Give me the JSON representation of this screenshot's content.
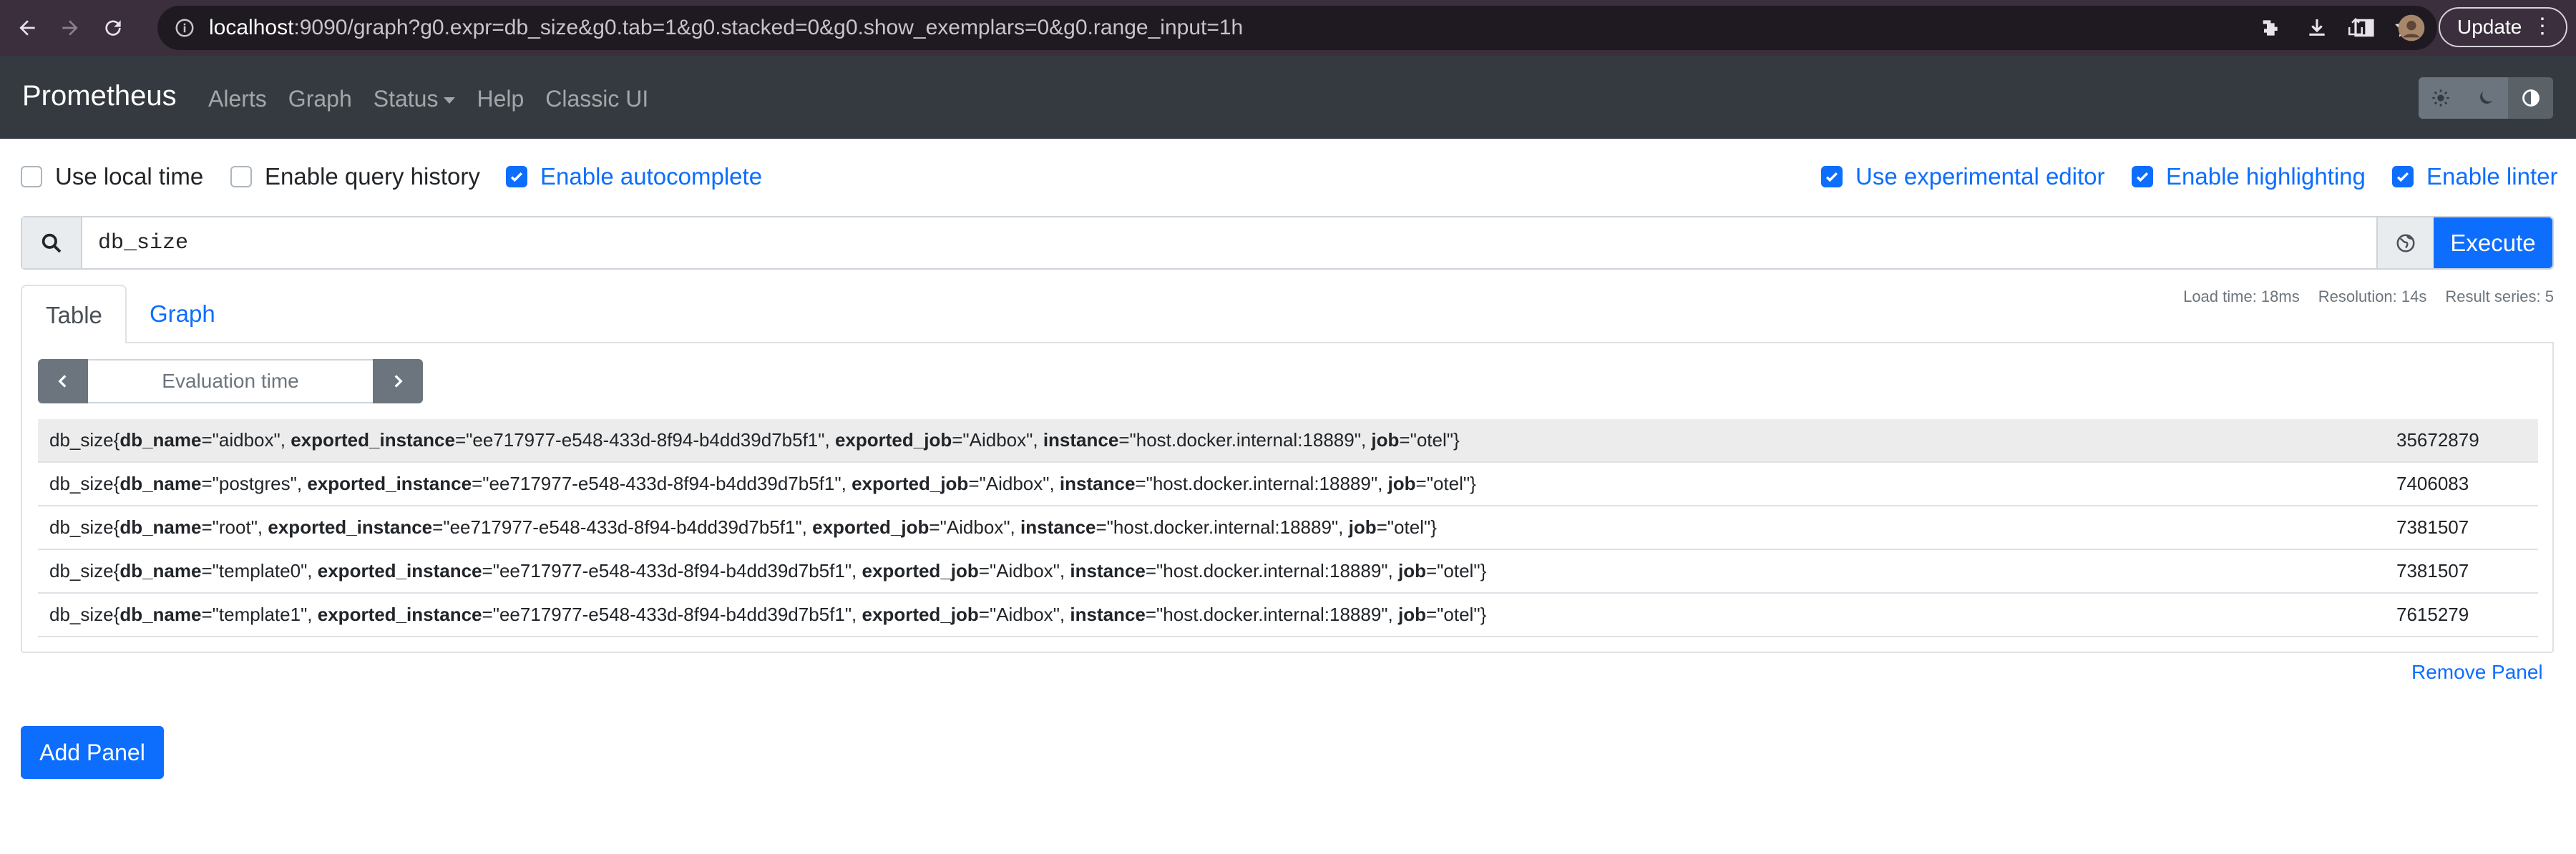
{
  "browser": {
    "url_host": "localhost",
    "url_rest": ":9090/graph?g0.expr=db_size&g0.tab=1&g0.stacked=0&g0.show_exemplars=0&g0.range_input=1h",
    "update_label": "Update"
  },
  "navbar": {
    "brand": "Prometheus",
    "links": [
      "Alerts",
      "Graph",
      "Status",
      "Help",
      "Classic UI"
    ]
  },
  "options": {
    "left": [
      {
        "label": "Use local time",
        "checked": false
      },
      {
        "label": "Enable query history",
        "checked": false
      },
      {
        "label": "Enable autocomplete",
        "checked": true
      }
    ],
    "right": [
      {
        "label": "Use experimental editor",
        "checked": true
      },
      {
        "label": "Enable highlighting",
        "checked": true
      },
      {
        "label": "Enable linter",
        "checked": true
      }
    ]
  },
  "query": {
    "expression": "db_size",
    "execute_label": "Execute"
  },
  "tabs": {
    "active": "Table",
    "inactive": "Graph"
  },
  "stats": {
    "load_time": "Load time: 18ms",
    "resolution": "Resolution: 14s",
    "result_series": "Result series: 5"
  },
  "eval_placeholder": "Evaluation time",
  "results": [
    {
      "db_name": "aidbox",
      "exported_instance": "ee717977-e548-433d-8f94-b4dd39d7b5f1",
      "exported_job": "Aidbox",
      "instance": "host.docker.internal:18889",
      "job": "otel",
      "value": "35672879"
    },
    {
      "db_name": "postgres",
      "exported_instance": "ee717977-e548-433d-8f94-b4dd39d7b5f1",
      "exported_job": "Aidbox",
      "instance": "host.docker.internal:18889",
      "job": "otel",
      "value": "7406083"
    },
    {
      "db_name": "root",
      "exported_instance": "ee717977-e548-433d-8f94-b4dd39d7b5f1",
      "exported_job": "Aidbox",
      "instance": "host.docker.internal:18889",
      "job": "otel",
      "value": "7381507"
    },
    {
      "db_name": "template0",
      "exported_instance": "ee717977-e548-433d-8f94-b4dd39d7b5f1",
      "exported_job": "Aidbox",
      "instance": "host.docker.internal:18889",
      "job": "otel",
      "value": "7381507"
    },
    {
      "db_name": "template1",
      "exported_instance": "ee717977-e548-433d-8f94-b4dd39d7b5f1",
      "exported_job": "Aidbox",
      "instance": "host.docker.internal:18889",
      "job": "otel",
      "value": "7615279"
    }
  ],
  "remove_panel_label": "Remove Panel",
  "add_panel_label": "Add Panel"
}
